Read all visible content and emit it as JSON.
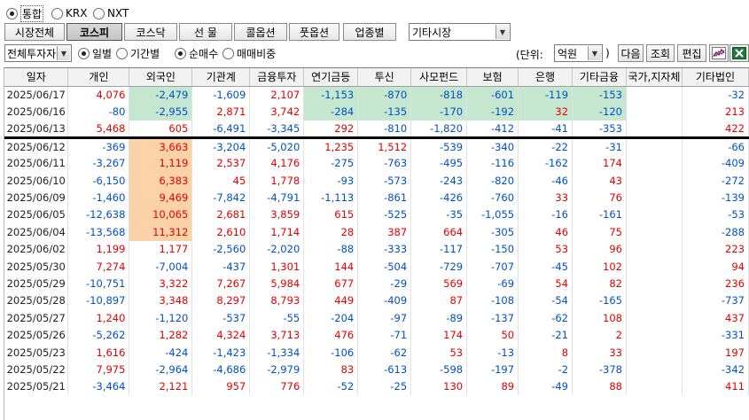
{
  "market_radio": [
    {
      "label": "통합",
      "selected": true
    },
    {
      "label": "KRX",
      "selected": false
    },
    {
      "label": "NXT",
      "selected": false
    }
  ],
  "tabs": [
    {
      "label": "시장전체",
      "active": false
    },
    {
      "label": "코스피",
      "active": true
    },
    {
      "label": "코스닥",
      "active": false
    },
    {
      "label": "선 물",
      "active": false
    },
    {
      "label": "콜옵션",
      "active": false
    },
    {
      "label": "풋옵션",
      "active": false
    },
    {
      "label": "업종별",
      "active": false
    }
  ],
  "other_market_select": "기타시장",
  "investor_select": "전체투자자",
  "period_radio": [
    {
      "label": "일별",
      "selected": true
    },
    {
      "label": "기간별",
      "selected": false
    }
  ],
  "type_radio": [
    {
      "label": "순매수",
      "selected": true
    },
    {
      "label": "매매비중",
      "selected": false
    }
  ],
  "unit_label": "(단위:",
  "unit_select": "억원",
  "unit_close": ")",
  "buttons": {
    "next": "다음",
    "query": "조회",
    "edit": "편집"
  },
  "icons": [
    "line-chart-icon",
    "excel-export-icon"
  ],
  "columns": [
    "일자",
    "개인",
    "외국인",
    "기관계",
    "금융투자",
    "연기금등",
    "투신",
    "사모펀드",
    "보험",
    "은행",
    "기타금융",
    "국가,지자체",
    "기타법인"
  ],
  "rows": [
    [
      "2025/06/17",
      "4,076",
      "-2,479",
      "-1,609",
      "2,107",
      "-1,153",
      "-870",
      "-818",
      "-601",
      "-119",
      "-153",
      "",
      "-32"
    ],
    [
      "2025/06/16",
      "-80",
      "-2,955",
      "2,871",
      "3,742",
      "-284",
      "-135",
      "-170",
      "-192",
      "32",
      "-120",
      "",
      "213"
    ],
    [
      "2025/06/13",
      "5,468",
      "605",
      "-6,491",
      "-3,345",
      "292",
      "-810",
      "-1,820",
      "-412",
      "-41",
      "-353",
      "",
      "422"
    ],
    [
      "2025/06/12",
      "-369",
      "3,663",
      "-3,204",
      "-5,020",
      "1,235",
      "1,512",
      "-539",
      "-340",
      "-22",
      "-31",
      "",
      "-66"
    ],
    [
      "2025/06/11",
      "-3,267",
      "1,119",
      "2,537",
      "4,176",
      "-275",
      "-763",
      "-495",
      "-116",
      "-162",
      "174",
      "",
      "-409"
    ],
    [
      "2025/06/10",
      "-6,150",
      "6,383",
      "45",
      "1,778",
      "-93",
      "-573",
      "-243",
      "-820",
      "-46",
      "43",
      "",
      "-272"
    ],
    [
      "2025/06/09",
      "-1,460",
      "9,469",
      "-7,842",
      "-4,791",
      "-1,113",
      "-861",
      "-426",
      "-760",
      "33",
      "76",
      "",
      "-139"
    ],
    [
      "2025/06/05",
      "-12,638",
      "10,065",
      "2,681",
      "3,859",
      "615",
      "-525",
      "-35",
      "-1,055",
      "-16",
      "-161",
      "",
      "-53"
    ],
    [
      "2025/06/04",
      "-13,568",
      "11,312",
      "2,610",
      "1,714",
      "28",
      "387",
      "664",
      "-305",
      "46",
      "75",
      "",
      "-288"
    ],
    [
      "2025/06/02",
      "1,199",
      "1,177",
      "-2,560",
      "-2,020",
      "-88",
      "-333",
      "-117",
      "-150",
      "53",
      "96",
      "",
      "223"
    ],
    [
      "2025/05/30",
      "7,274",
      "-7,004",
      "-437",
      "1,301",
      "144",
      "-504",
      "-729",
      "-707",
      "-45",
      "102",
      "",
      "94"
    ],
    [
      "2025/05/29",
      "-10,751",
      "3,322",
      "7,267",
      "5,984",
      "677",
      "-29",
      "569",
      "-69",
      "54",
      "82",
      "",
      "236"
    ],
    [
      "2025/05/28",
      "-10,897",
      "3,348",
      "8,297",
      "8,793",
      "449",
      "-409",
      "87",
      "-108",
      "-54",
      "-165",
      "",
      "-737"
    ],
    [
      "2025/05/27",
      "1,240",
      "-1,120",
      "-537",
      "-55",
      "-204",
      "-97",
      "-89",
      "-137",
      "-62",
      "108",
      "",
      "437"
    ],
    [
      "2025/05/26",
      "-5,262",
      "1,282",
      "4,324",
      "3,713",
      "476",
      "-71",
      "174",
      "50",
      "-21",
      "2",
      "",
      "-331"
    ],
    [
      "2025/05/23",
      "1,616",
      "-424",
      "-1,423",
      "-1,334",
      "-106",
      "-62",
      "53",
      "-13",
      "8",
      "33",
      "",
      "197"
    ],
    [
      "2025/05/22",
      "7,975",
      "-2,964",
      "-4,686",
      "-2,979",
      "83",
      "-613",
      "-598",
      "-197",
      "-2",
      "-378",
      "",
      "-342"
    ],
    [
      "2025/05/21",
      "-3,464",
      "2,121",
      "957",
      "776",
      "-52",
      "-25",
      "130",
      "89",
      "-49",
      "88",
      "",
      "411"
    ]
  ],
  "highlights": {
    "green": [
      [
        0,
        2
      ],
      [
        1,
        2
      ],
      [
        0,
        5
      ],
      [
        1,
        5
      ],
      [
        0,
        6
      ],
      [
        1,
        6
      ],
      [
        0,
        7
      ],
      [
        1,
        7
      ],
      [
        0,
        8
      ],
      [
        1,
        8
      ],
      [
        0,
        9
      ],
      [
        1,
        9
      ],
      [
        0,
        10
      ],
      [
        1,
        10
      ]
    ],
    "orange": [
      [
        3,
        2
      ],
      [
        4,
        2
      ],
      [
        5,
        2
      ],
      [
        6,
        2
      ],
      [
        7,
        2
      ],
      [
        8,
        2
      ]
    ]
  },
  "separator_after_row": 2
}
